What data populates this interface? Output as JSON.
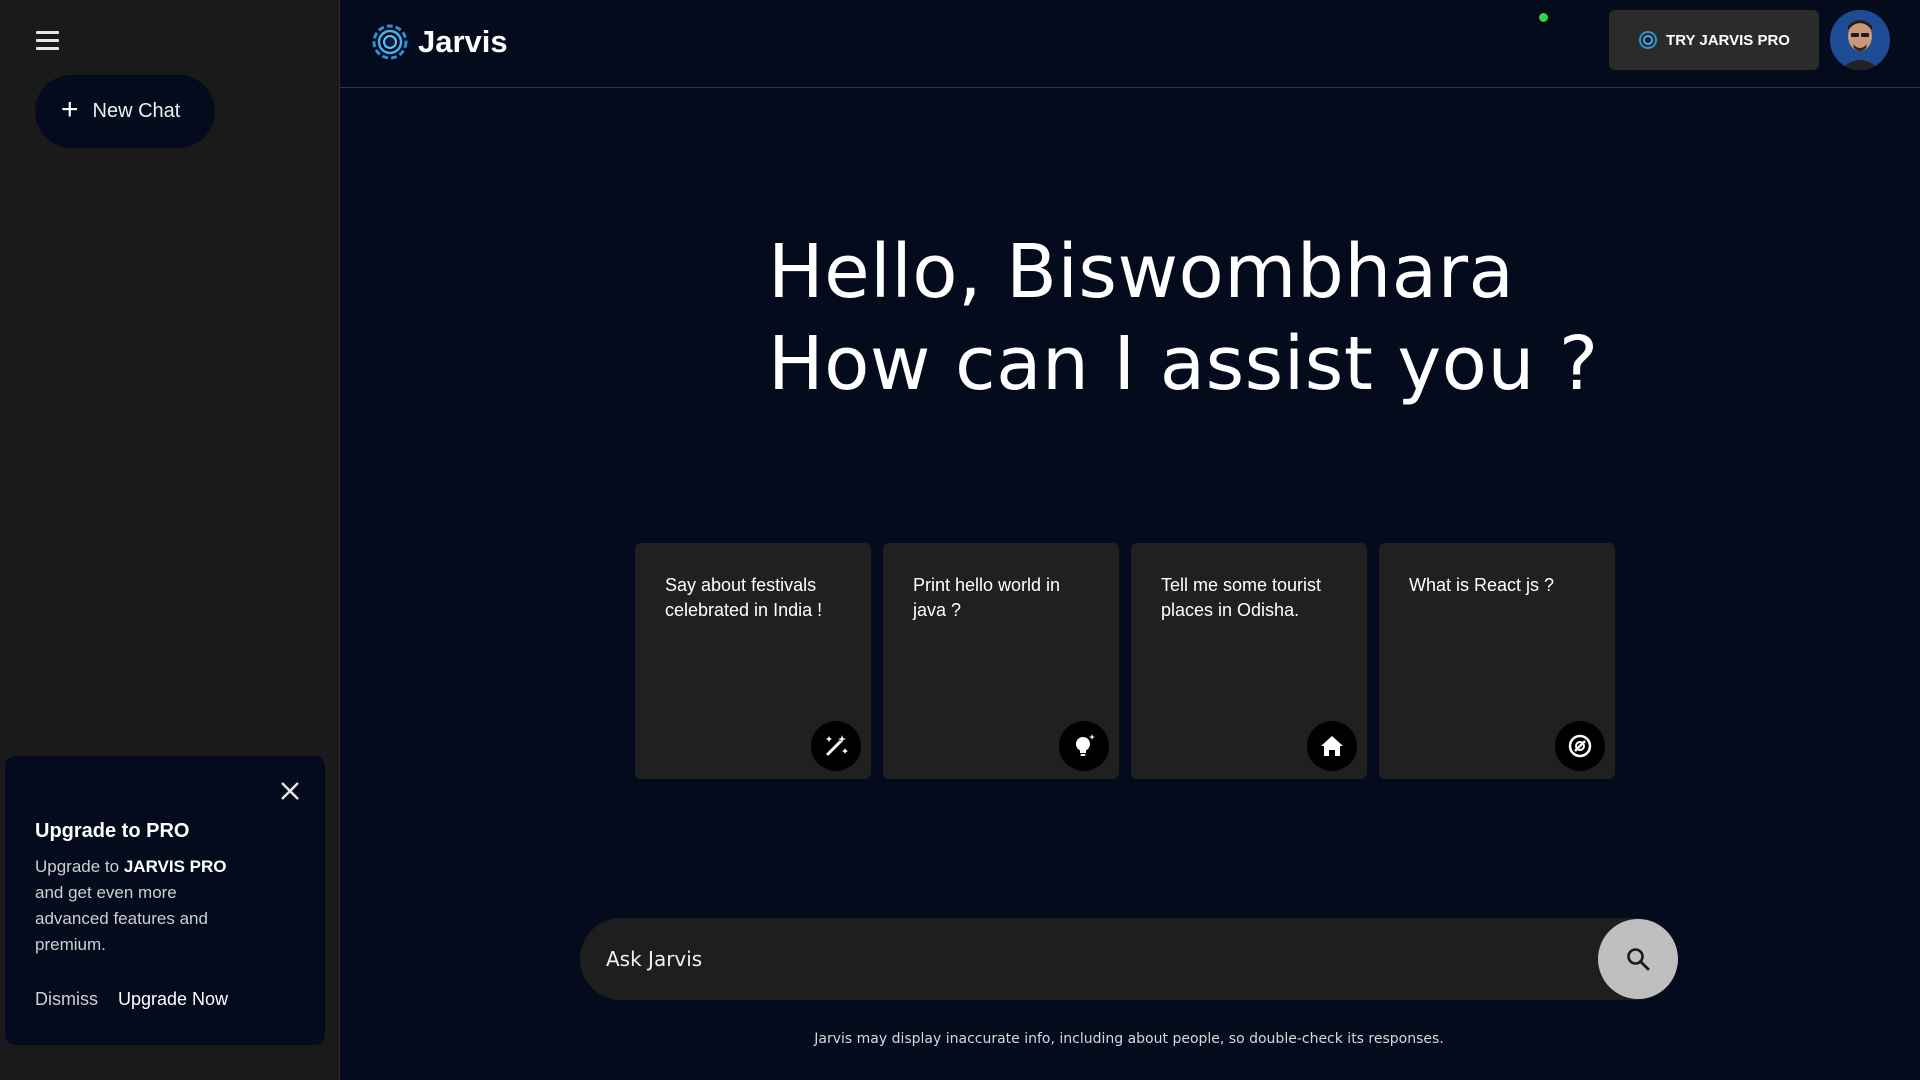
{
  "sidebar": {
    "new_chat_label": "New Chat",
    "upgrade": {
      "title": "Upgrade to PRO",
      "text_before": "Upgrade to ",
      "text_bold": "JARVIS PRO",
      "text_after": " and get even more advanced features and premium.",
      "dismiss": "Dismiss",
      "upgrade_now": "Upgrade Now"
    }
  },
  "header": {
    "brand": "Jarvis",
    "pro_button": "TRY JARVIS PRO",
    "avatar_status": "online"
  },
  "greeting": {
    "line1": "Hello, Biswombhara",
    "line2": "How can I assist you ?"
  },
  "cards": [
    {
      "text": "Say about festivals celebrated in India !",
      "icon": "magic-wand-icon"
    },
    {
      "text": "Print hello world in java ?",
      "icon": "lightbulb-icon"
    },
    {
      "text": "Tell me some tourist places in Odisha.",
      "icon": "home-icon"
    },
    {
      "text": "What is React js ?",
      "icon": "code-ring-icon"
    }
  ],
  "search": {
    "placeholder": "Ask Jarvis"
  },
  "disclaimer": "Jarvis may display inaccurate info, including about people, so double-check its responses.",
  "colors": {
    "background": "#030b1c",
    "sidebar": "#1a1a1a",
    "card": "#202020",
    "status_online": "#35d34a"
  }
}
